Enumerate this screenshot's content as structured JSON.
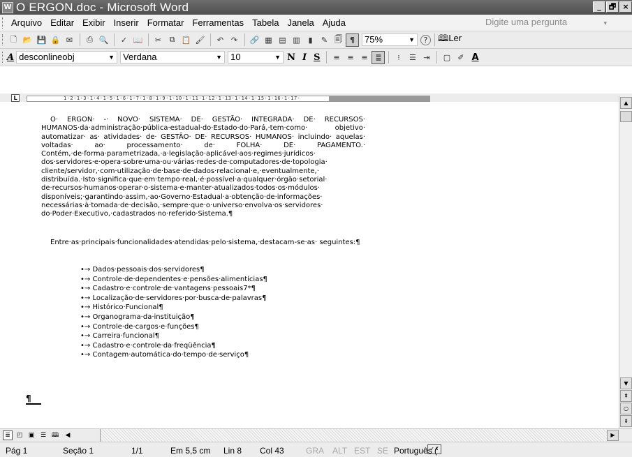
{
  "window": {
    "app_icon": "W",
    "title": "O ERGON.doc - Microsoft Word",
    "controls": [
      "_",
      "🗗",
      "×"
    ]
  },
  "menu": {
    "items": [
      "Arquivo",
      "Editar",
      "Exibir",
      "Inserir",
      "Formatar",
      "Ferramentas",
      "Tabela",
      "Janela",
      "Ajuda"
    ],
    "ask_placeholder": "Digite uma pergunta",
    "ask_arrow": "▾"
  },
  "toolbar_standard": {
    "icons": [
      "new-icon",
      "open-icon",
      "save-icon",
      "permission-icon",
      "email-icon",
      "print-icon",
      "print-preview-icon",
      "spelling-icon",
      "research-icon",
      "cut-icon",
      "copy-icon",
      "paste-icon",
      "format-painter-icon",
      "undo-icon",
      "redo-icon",
      "hyperlink-icon",
      "tables-borders-icon",
      "insert-table-icon",
      "insert-excel-icon",
      "columns-icon",
      "drawing-icon",
      "document-map-icon",
      "show-hide-icon"
    ],
    "show_hide_symbol": "¶",
    "zoom": "75%",
    "help_symbol": "?",
    "read_label": "Ler"
  },
  "toolbar_format": {
    "style_icon": "A",
    "style": "desconlineobj",
    "font": "Verdana",
    "size": "10",
    "bold": "N",
    "italic": "I",
    "underline": "S",
    "font_color_letter": "A"
  },
  "ruler": {
    "tab_selector": "L",
    "numbers": "1·2·1·3·1·4·1·5·1·6·1·7·1·8·1·9·1·10·1·11·1·12·1·13·1·14·1·15·1·16·1·17·"
  },
  "document": {
    "paragraph1": "O· ERGON· -· NOVO· SISTEMA· DE· GESTÃO· INTEGRADA· DE· RECURSOS· HUMANOS·da·administração·pública·estadual·do·Estado·do·Pará,·tem·como· objetivo· automatizar· as· atividades· de· GESTÃO· DE· RECURSOS· HUMANOS· incluindo· aquelas· voltadas· ao· processamento· de· FOLHA· DE· PAGAMENTO.· Contém,·de·forma·parametrizada,·a·legislação·aplicável·aos·regimes·jurídicos· dos·servidores·e·opera·sobre·uma·ou·várias·redes·de·computadores·de·topologia· cliente/servidor,·com·utilização·de·base·de·dados·relacional·e,·eventualmente,· distribuída.·Isto·significa·que·em·tempo·real,·é·possível·a·qualquer·órgão·setorial· de·recursos·humanos·operar·o·sistema·e·manter·atualizados·todos·os·módulos· disponíveis;·garantindo·assim,·ao·Governo·Estadual·a·obtenção·de·informações· necessárias·à·tomada·de·decisão,·sempre·que·o·universo·envolva·os·servidores· do·Poder·Executivo,·cadastrados·no·referido·Sistema.¶",
    "paragraph2": "Entre·as·principais·funcionalidades·atendidas·pelo·sistema,·destacam-se·as· seguintes:¶",
    "bullet_prefix": "•→ ",
    "bullets": [
      "Dados·pessoais·dos·servidores¶",
      "Controle·de·dependentes·e·pensões·alimentícias¶",
      "Cadastro·e·controle·de·vantagens·pessoais7*¶",
      "Localização·de·servidores·por·busca·de·palavras¶",
      "Histórico·Funcional¶",
      "Organograma·da·instituição¶",
      "Controle·de·cargos·e·funções¶",
      "Carreira·funcional¶",
      "Cadastro·e·controle·da·freqüência¶",
      "Contagem·automática·do·tempo·de·serviço¶"
    ],
    "end_mark": "¶"
  },
  "status": {
    "page": "Pág 1",
    "section": "Seção 1",
    "pages": "1/1",
    "position": "Em 5,5 cm",
    "line": "Lin 8",
    "col": "Col 43",
    "rec": "GRA",
    "trk": "ALT",
    "ext": "EST",
    "ovr": "SE",
    "language": "Português (",
    "spelling_icon": "spell-status-icon"
  }
}
